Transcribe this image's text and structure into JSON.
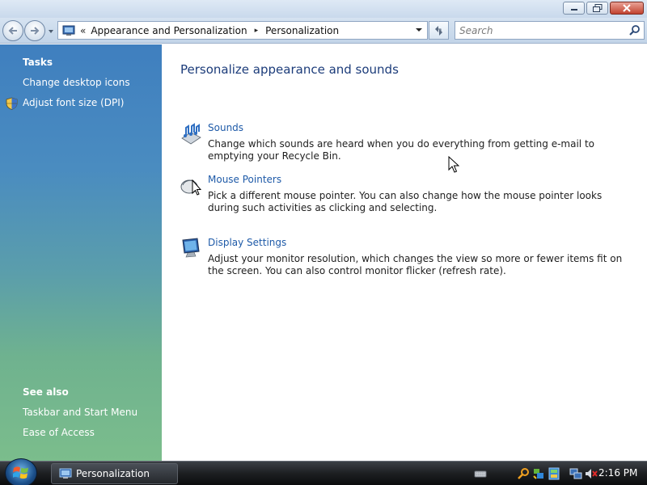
{
  "window": {
    "title": "Personalization",
    "controls": {
      "minimize": "minimize-icon",
      "maximize": "maximize-icon",
      "close": "close-icon"
    }
  },
  "address_bar": {
    "overflow": "«",
    "breadcrumbs": [
      "Appearance and Personalization",
      "Personalization"
    ],
    "separator": "▸"
  },
  "search": {
    "placeholder": "Search",
    "value": ""
  },
  "sidebar": {
    "tasks_heading": "Tasks",
    "tasks": [
      {
        "label": "Change desktop icons",
        "icon": null
      },
      {
        "label": "Adjust font size (DPI)",
        "icon": "shield-icon"
      }
    ],
    "see_also_heading": "See also",
    "see_also": [
      {
        "label": "Taskbar and Start Menu"
      },
      {
        "label": "Ease of Access"
      }
    ]
  },
  "main": {
    "title": "Personalize appearance and sounds",
    "items": [
      {
        "link": "Sounds",
        "icon": "sounds-icon",
        "description": "Change which sounds are heard when you do everything from getting e-mail to emptying your Recycle Bin."
      },
      {
        "link": "Mouse Pointers",
        "icon": "mouse-icon",
        "description": "Pick a different mouse pointer. You can also change how the mouse pointer looks during such activities as clicking and selecting."
      },
      {
        "link": "Display Settings",
        "icon": "display-icon",
        "description": "Adjust your monitor resolution, which changes the view so more or fewer items fit on the screen. You can also control monitor flicker (refresh rate)."
      }
    ]
  },
  "taskbar": {
    "task_label": "Personalization",
    "clock": "2:16 PM",
    "tray_icons": [
      "keyboard-icon",
      "search-icon",
      "sidebar-icon",
      "network-icon",
      "volume-muted-icon"
    ]
  },
  "colors": {
    "link": "#1e5aa8",
    "title": "#1c3c7a",
    "sidebar_top": "#3f7fbf",
    "sidebar_bottom": "#7bbd8c"
  }
}
